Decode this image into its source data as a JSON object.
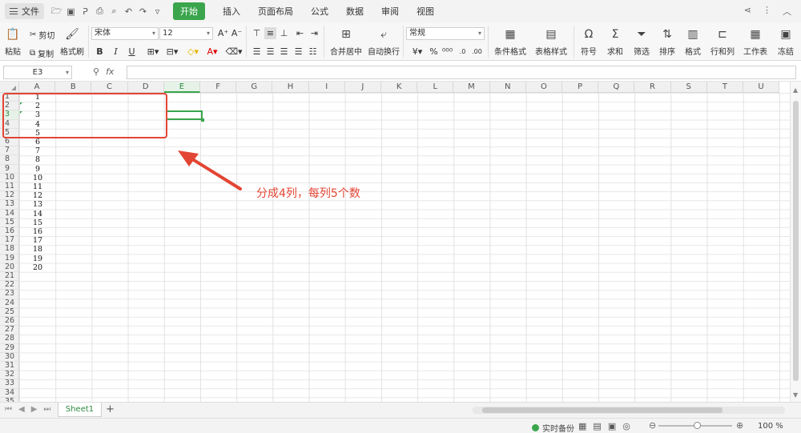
{
  "app": {
    "file_menu": "文件",
    "tabs": [
      "开始",
      "插入",
      "页面布局",
      "公式",
      "数据",
      "审阅",
      "视图"
    ],
    "active_tab": "开始"
  },
  "ribbon": {
    "paste": "粘贴",
    "cut": "剪切",
    "copy": "复制",
    "format_painter": "格式刷",
    "font_name": "宋体",
    "font_size": "12",
    "merge_center": "合并居中",
    "wrap_text": "自动换行",
    "number_format": "常规",
    "conditional_format": "条件格式",
    "table_style": "表格样式",
    "symbol": "符号",
    "sum": "求和",
    "filter": "筛选",
    "sort": "排序",
    "format": "格式",
    "row_col": "行和列",
    "worksheet": "工作表",
    "freeze": "冻结"
  },
  "formula_bar": {
    "name_box": "E3",
    "fx": "fx",
    "value": ""
  },
  "grid": {
    "columns": [
      "A",
      "B",
      "C",
      "D",
      "E",
      "F",
      "G",
      "H",
      "I",
      "J",
      "K",
      "L",
      "M",
      "N",
      "O",
      "P",
      "Q",
      "R",
      "S",
      "T",
      "U"
    ],
    "active_column": "E",
    "active_row": 3,
    "column_a_values": [
      "1",
      "2",
      "3",
      "4",
      "5",
      "6",
      "7",
      "8",
      "9",
      "10",
      "11",
      "12",
      "13",
      "14",
      "15",
      "16",
      "17",
      "18",
      "19",
      "20"
    ],
    "row_count": 35
  },
  "annotation": {
    "text": "分成4列，每列5个数",
    "color": "#e34534"
  },
  "sheets": {
    "tabs": [
      "Sheet1"
    ],
    "add": "+"
  },
  "status": {
    "backup": "实时备份",
    "zoom": "100 %"
  },
  "colors": {
    "accent": "#3aa54c",
    "annotation": "#e34534"
  }
}
